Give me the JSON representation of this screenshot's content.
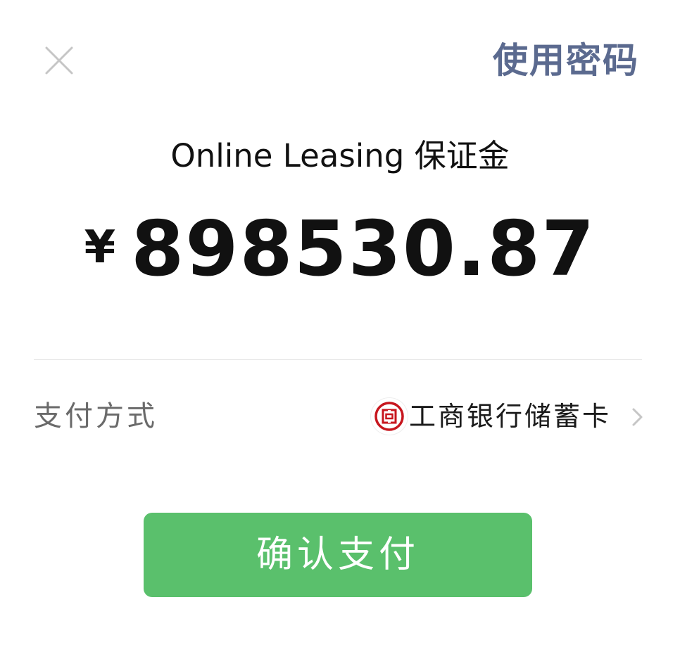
{
  "header": {
    "close_icon": "close-icon",
    "use_password_label": "使用密码"
  },
  "order": {
    "title": "Online Leasing 保证金",
    "currency_symbol": "¥",
    "amount": "898530.87"
  },
  "payment_method": {
    "label": "支付方式",
    "bank_icon": "icbc-bank-icon",
    "bank_name": "工商银行储蓄卡",
    "chevron_icon": "chevron-right-icon"
  },
  "confirm_button": {
    "label": "确认支付"
  },
  "colors": {
    "accent_text": "#5b6a8f",
    "confirm_green": "#5ac06c",
    "bank_red": "#c7161e",
    "muted_text": "#6a6a6a",
    "icon_gray": "#c6c6c6"
  }
}
